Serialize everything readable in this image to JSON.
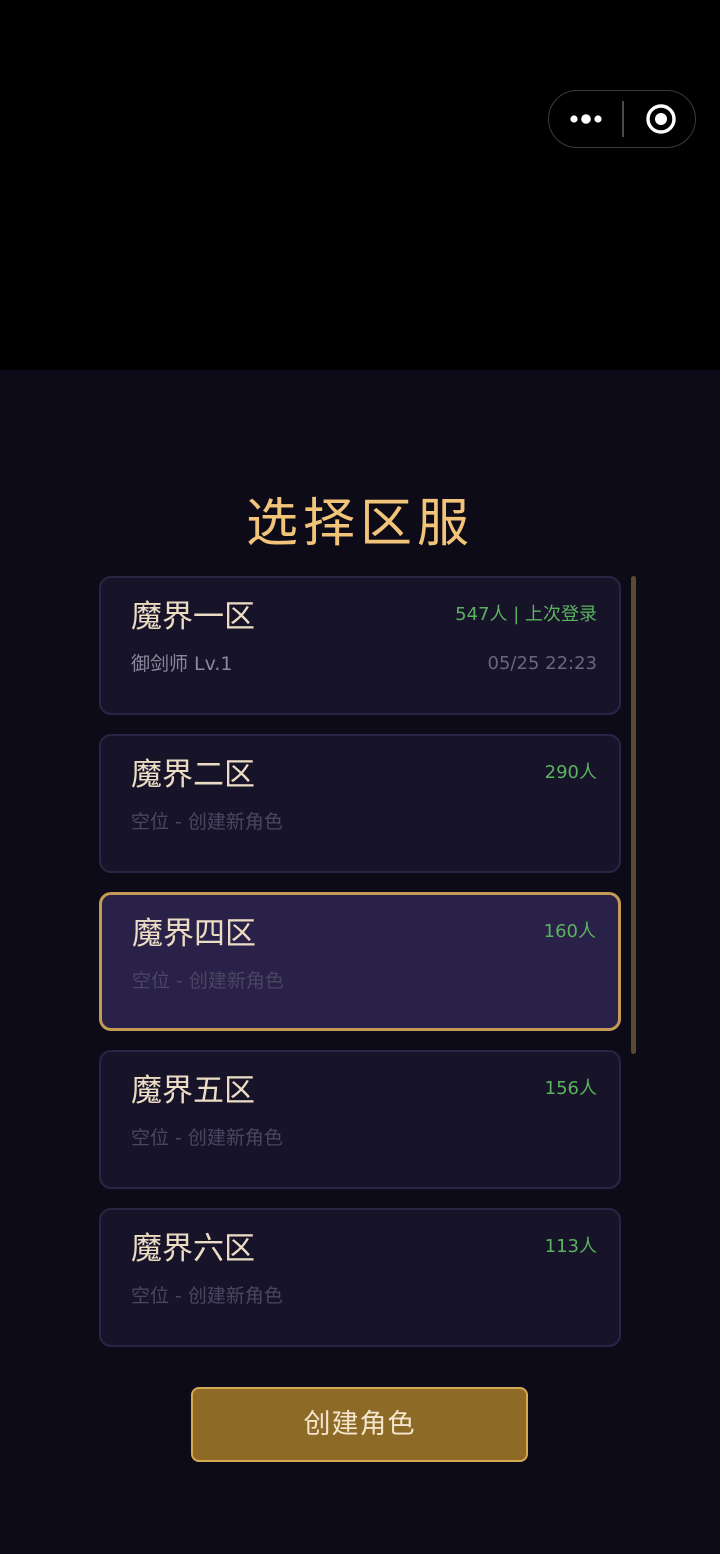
{
  "page": {
    "title": "选择区服"
  },
  "capsule": {
    "more_icon": "more-dots-icon",
    "close_icon": "target-circle-icon"
  },
  "servers": [
    {
      "name": "魔界一区",
      "count": "547人 | 上次登录",
      "role": "御剑师 Lv.1",
      "time": "05/25 22:23",
      "selected": false
    },
    {
      "name": "魔界二区",
      "count": "290人",
      "role": "空位 - 创建新角色",
      "time": "",
      "selected": false
    },
    {
      "name": "魔界四区",
      "count": "160人",
      "role": "空位 - 创建新角色",
      "time": "",
      "selected": true
    },
    {
      "name": "魔界五区",
      "count": "156人",
      "role": "空位 - 创建新角色",
      "time": "",
      "selected": false
    },
    {
      "name": "魔界六区",
      "count": "113人",
      "role": "空位 - 创建新角色",
      "time": "",
      "selected": false
    }
  ],
  "actions": {
    "create_label": "创建角色"
  },
  "colors": {
    "accent_gold": "#f2c47a",
    "online_green": "#5ab35e",
    "button_gold": "#8e6a27",
    "selected_border": "#c49a55"
  }
}
